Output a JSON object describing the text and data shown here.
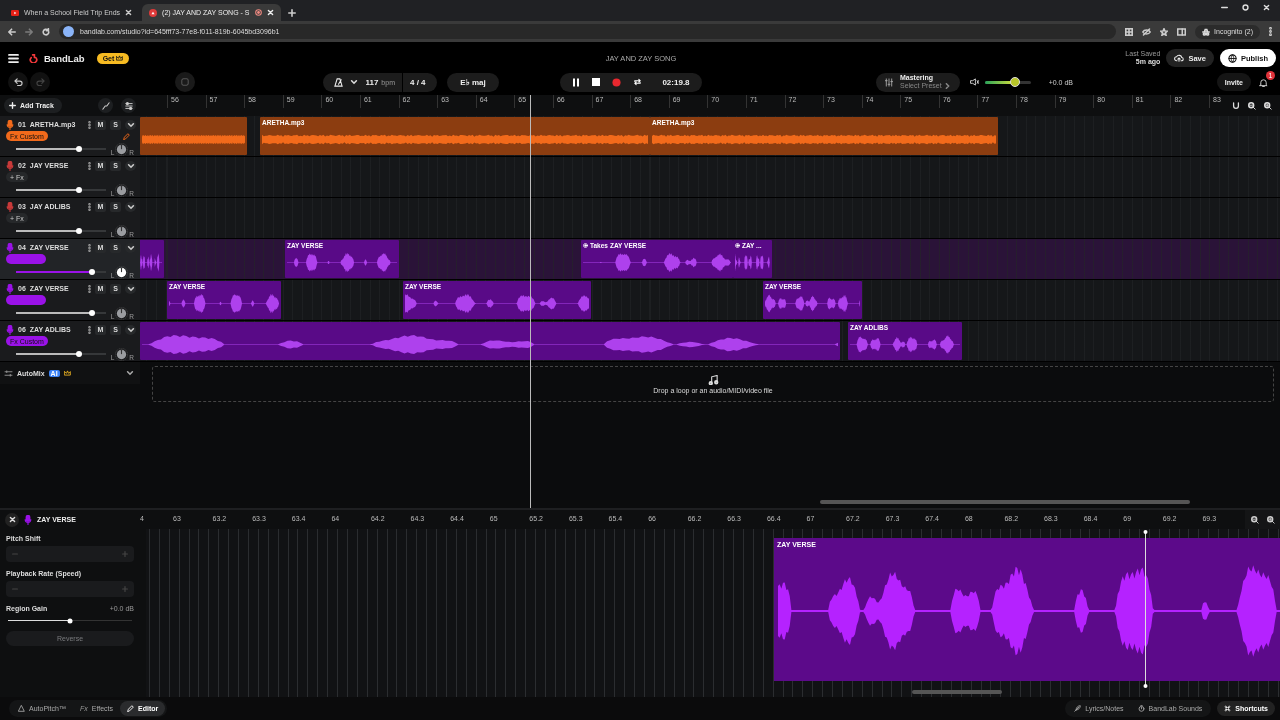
{
  "browser": {
    "tabs": [
      {
        "title": "When a School Field Trip Ends",
        "selected": false
      },
      {
        "title": "(2) JAY AND ZAY SONG - S",
        "selected": true
      }
    ],
    "url": "bandlab.com/studio?id=645fff73-77e8-f011-819b-6045bd3096b1",
    "profile": "Incognito (2)"
  },
  "header": {
    "logo": "BandLab",
    "get": "Get",
    "title": "JAY AND ZAY SONG",
    "last_saved_label": "Last Saved",
    "last_saved_time": "5m ago",
    "save": "Save",
    "publish": "Publish",
    "invite": "Invite",
    "notifications": "1"
  },
  "transport": {
    "tempo": "117",
    "tempo_unit": "bpm",
    "meter": "4 / 4",
    "key": "E♭ maj",
    "playing": true,
    "time": "02:19.8"
  },
  "mastering": {
    "title": "Mastering",
    "preset": "Select Preset"
  },
  "master_volume": {
    "level": 0.65,
    "reading": "+0.0 dB"
  },
  "arrange": {
    "add_track": "Add Track",
    "ruler": [
      "56",
      "57",
      "58",
      "59",
      "60",
      "61",
      "62",
      "63",
      "64",
      "65",
      "66",
      "67",
      "68",
      "69",
      "70",
      "71",
      "72",
      "73",
      "74",
      "75",
      "76",
      "77",
      "78",
      "79",
      "80",
      "81",
      "82",
      "83"
    ],
    "automix": "AutoMix",
    "automix_badge": "AI",
    "drop_hint": "Drop a loop or an audio/MIDI/video file"
  },
  "tracks": [
    {
      "number": "01",
      "name": "ARETHA.mp3",
      "kind": "audio",
      "color": "#f26a1b",
      "selected": false,
      "mute": "M",
      "solo": "S",
      "fx": {
        "label": "Fx Custom",
        "active": true
      },
      "volume": {
        "level": 0.7
      },
      "pan": {
        "left": "L",
        "right": "R"
      },
      "clips": [
        {
          "takes": false
        },
        {
          "label": "ARETHA.mp3",
          "takes": false
        },
        {
          "label": "ARETHA.mp3",
          "takes": false
        }
      ]
    },
    {
      "number": "02",
      "name": "JAY VERSE",
      "kind": "voice",
      "color": "#c83a3a",
      "selected": false,
      "mute": "M",
      "solo": "S",
      "fx": {
        "label": "+ Fx",
        "active": false
      },
      "volume": {
        "level": 0.7
      },
      "pan": {
        "left": "L",
        "right": "R"
      }
    },
    {
      "number": "03",
      "name": "JAY ADLIBS",
      "kind": "voice",
      "color": "#c83a3a",
      "selected": false,
      "mute": "M",
      "solo": "S",
      "fx": {
        "label": "+ Fx",
        "active": false
      },
      "volume": {
        "level": 0.7
      },
      "pan": {
        "left": "L",
        "right": "R"
      }
    },
    {
      "number": "04",
      "name": "ZAY VERSE",
      "kind": "voice",
      "color": "#9a12e8",
      "selected": true,
      "mute": "M",
      "solo": "S",
      "fx": {
        "active": true
      },
      "volume": {
        "level": 0.84
      },
      "pan": {
        "left": "L",
        "right": "R"
      },
      "clips": [
        {
          "takes": false
        },
        {
          "label": "ZAY VERSE",
          "takes": false
        },
        {
          "takes_label": "Takes",
          "label": "ZAY VERSE",
          "takes": true
        },
        {
          "label": "ZAY ...",
          "takes": true
        }
      ]
    },
    {
      "number": "06",
      "name": "ZAY VERSE",
      "kind": "voice",
      "color": "#9a12e8",
      "selected": false,
      "mute": "M",
      "solo": "S",
      "fx": {
        "active": true
      },
      "volume": {
        "level": 0.84
      },
      "pan": {
        "left": "L",
        "right": "R"
      },
      "clips": [
        {
          "label": "ZAY VERSE",
          "takes": false
        },
        {
          "label": "ZAY VERSE",
          "takes": false
        },
        {
          "label": "ZAY VERSE",
          "takes": false
        }
      ]
    },
    {
      "number": "06",
      "name": "ZAY ADLIBS",
      "kind": "voice",
      "color": "#9a12e8",
      "selected": false,
      "mute": "M",
      "solo": "S",
      "fx": {
        "label": "Fx Custom",
        "active": true
      },
      "volume": {
        "level": 0.7
      },
      "pan": {
        "left": "L",
        "right": "R"
      },
      "clips": [
        {
          "takes": false
        },
        {
          "label": "ZAY ADLIBS",
          "takes": false
        }
      ]
    }
  ],
  "editor": {
    "track": "ZAY VERSE",
    "pitch_shift": "Pitch Shift",
    "playback_rate": "Playback Rate (Speed)",
    "region_gain": "Region Gain",
    "gain_reading": "+0.0 dB",
    "gain": {
      "level": 0.5
    },
    "reverse": {
      "label": "Reverse",
      "disabled": true
    },
    "ruler": [
      "4",
      "63",
      "63.2",
      "63.3",
      "63.4",
      "64",
      "64.2",
      "64.3",
      "64.4",
      "65",
      "65.2",
      "65.3",
      "65.4",
      "66",
      "66.2",
      "66.3",
      "66.4",
      "67",
      "67.2",
      "67.3",
      "67.4",
      "68",
      "68.2",
      "68.3",
      "68.4",
      "69",
      "69.2",
      "69.3"
    ],
    "clip": "ZAY VERSE"
  },
  "footer": {
    "tabs": [
      {
        "label": "AutoPitch™",
        "selected": false
      },
      {
        "icon_text": "Fx",
        "label": "Effects",
        "selected": false
      },
      {
        "label": "Editor",
        "selected": true
      }
    ],
    "links": [
      "Lyrics/Notes",
      "BandLab Sounds"
    ],
    "shortcuts": "Shortcuts"
  }
}
